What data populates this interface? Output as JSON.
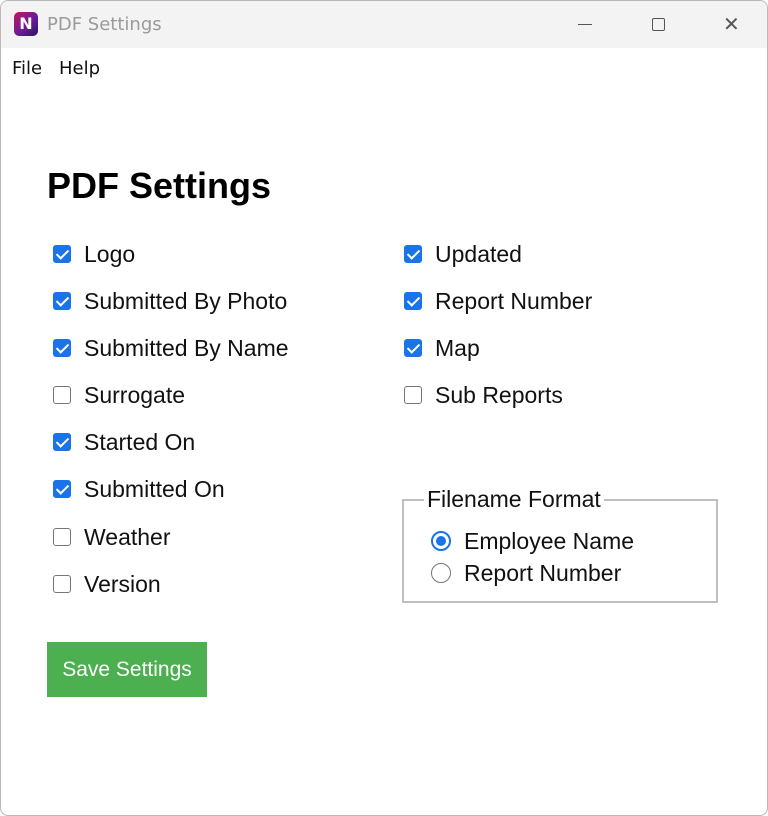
{
  "window": {
    "title": "PDF Settings",
    "app_icon_letter": "N",
    "controls": {
      "minimize": "minimize-icon",
      "maximize": "maximize-icon",
      "close": "close-icon",
      "close_glyph": "✕"
    }
  },
  "menu": {
    "file": "File",
    "help": "Help"
  },
  "page": {
    "title": "PDF Settings"
  },
  "options": {
    "logo": {
      "label": "Logo",
      "checked": true
    },
    "submitted_by_photo": {
      "label": "Submitted By Photo",
      "checked": true
    },
    "submitted_by_name": {
      "label": "Submitted By Name",
      "checked": true
    },
    "surrogate": {
      "label": "Surrogate",
      "checked": false
    },
    "started_on": {
      "label": "Started On",
      "checked": true
    },
    "submitted_on": {
      "label": "Submitted On",
      "checked": true
    },
    "weather": {
      "label": "Weather",
      "checked": false
    },
    "version": {
      "label": "Version",
      "checked": false
    },
    "updated": {
      "label": "Updated",
      "checked": true
    },
    "report_number": {
      "label": "Report Number",
      "checked": true
    },
    "map": {
      "label": "Map",
      "checked": true
    },
    "sub_reports": {
      "label": "Sub Reports",
      "checked": false
    }
  },
  "filename_format": {
    "legend": "Filename Format",
    "employee_name": {
      "label": "Employee Name",
      "selected": true
    },
    "report_number": {
      "label": "Report Number",
      "selected": false
    }
  },
  "actions": {
    "save_label": "Save Settings"
  },
  "colors": {
    "accent": "#1a73e8",
    "save_button": "#4caf50"
  }
}
